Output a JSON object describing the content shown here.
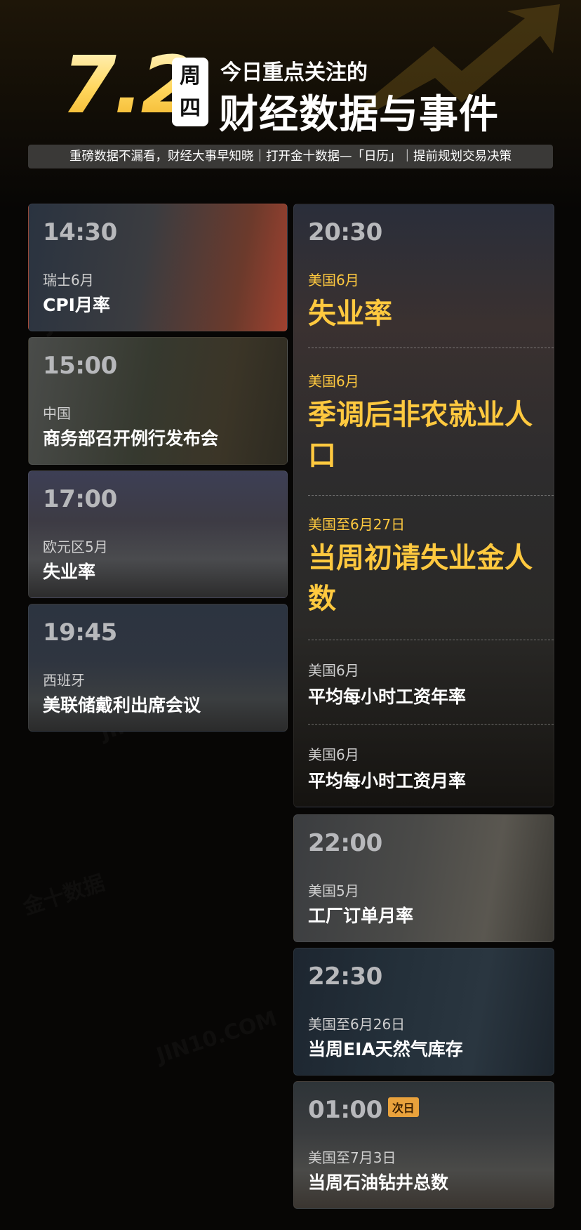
{
  "header": {
    "date": "7.2",
    "weekday": "周四",
    "subtitle": "今日重点关注的",
    "title": "财经数据与事件",
    "tagline": "重磅数据不漏看，财经大事早知晓｜打开金十数据—「日历」｜提前规划交易决策"
  },
  "left_events": [
    {
      "time": "14:30",
      "region": "瑞士6月",
      "event": "CPI月率"
    },
    {
      "time": "15:00",
      "region": "中国",
      "event": "商务部召开例行发布会"
    },
    {
      "time": "17:00",
      "region": "欧元区5月",
      "event": "失业率"
    },
    {
      "time": "19:45",
      "region": "西班牙",
      "event": "美联储戴利出席会议"
    }
  ],
  "us_block": {
    "time": "20:30",
    "items": [
      {
        "region": "美国6月",
        "event": "失业率"
      },
      {
        "region": "美国6月",
        "event": "季调后非农就业人口"
      },
      {
        "region": "美国至6月27日",
        "event": "当周初请失业金人数"
      },
      {
        "region": "美国6月",
        "event": "平均每小时工资年率"
      },
      {
        "region": "美国6月",
        "event": "平均每小时工资月率"
      }
    ]
  },
  "right_events": [
    {
      "time": "22:00",
      "region": "美国5月",
      "event": "工厂订单月率"
    },
    {
      "time": "22:30",
      "region": "美国至6月26日",
      "event": "当周EIA天然气库存"
    },
    {
      "time": "01:00",
      "badge": "次日",
      "region": "美国至7月3日",
      "event": "当周石油钻井总数"
    }
  ],
  "colors": {
    "accent": "#ffc93f",
    "badge": "#e9a23c",
    "card_bg": "#2a2623"
  }
}
